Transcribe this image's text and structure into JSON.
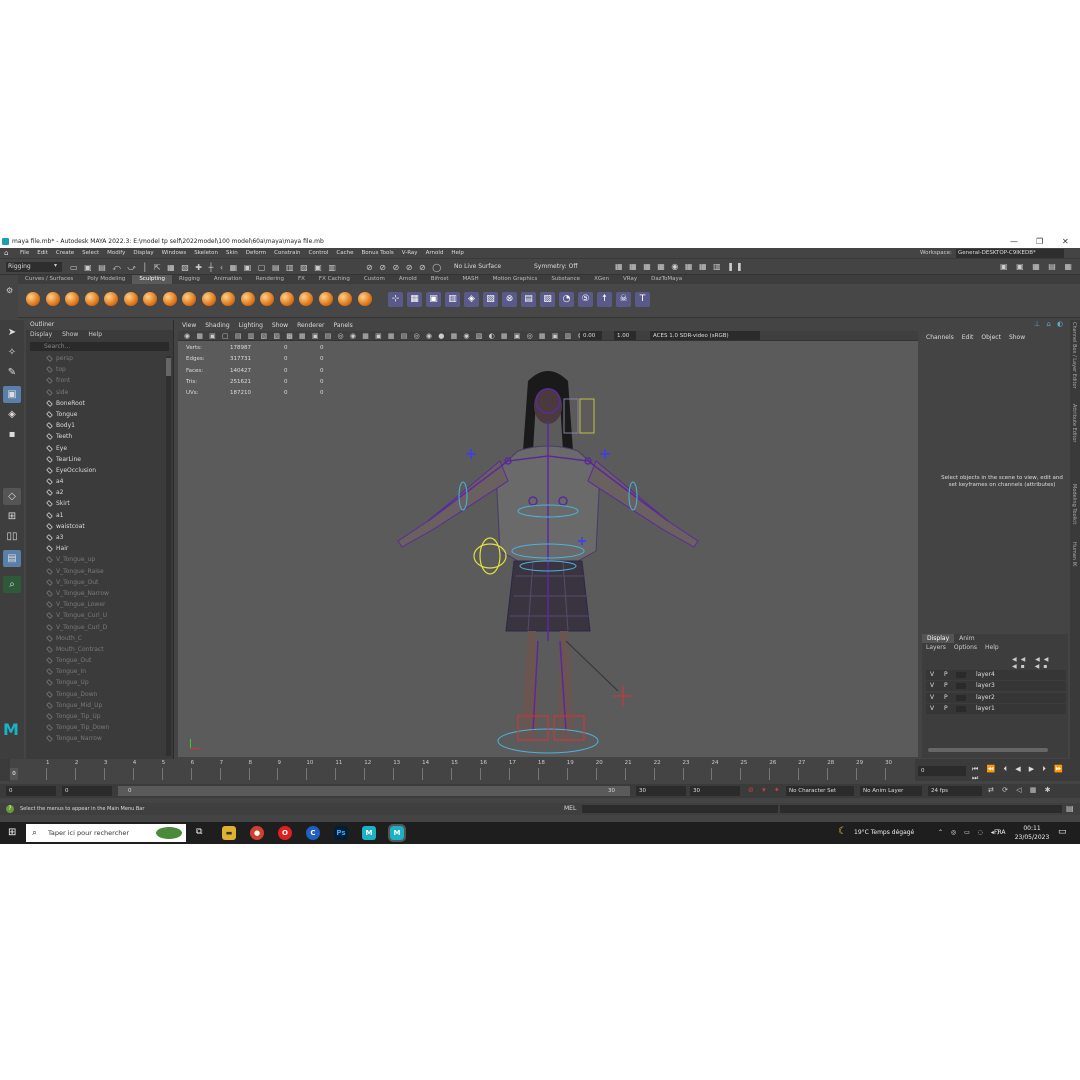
{
  "window": {
    "title": "maya file.mb* - Autodesk MAYA 2022.3: E:\\model tp self\\2022model\\100 model\\60a\\maya\\maya file.mb",
    "min": "—",
    "max": "❐",
    "close": "✕"
  },
  "menubar": {
    "items": [
      "File",
      "Edit",
      "Create",
      "Select",
      "Modify",
      "Display",
      "Windows",
      "Skeleton",
      "Skin",
      "Deform",
      "Constrain",
      "Control",
      "Cache",
      "Bonus Tools",
      "V-Ray",
      "Arnold",
      "Help"
    ],
    "workspace_label": "Workspace:",
    "workspace_value": "General-DESKTOP-C9IKEDB*"
  },
  "statusline": {
    "mode": "Rigging",
    "live_surface": "No Live Surface",
    "symmetry": "Symmetry: Off"
  },
  "shelf": {
    "tabs": [
      "Curves / Surfaces",
      "Poly Modeling",
      "Sculpting",
      "Rigging",
      "Animation",
      "Rendering",
      "FX",
      "FX Caching",
      "Custom",
      "Arnold",
      "Bifrost",
      "MASH",
      "Motion Graphics",
      "Substance",
      "XGen",
      "VRay",
      "DazToMaya"
    ],
    "active_tab": "Sculpting"
  },
  "outliner": {
    "title": "Outliner",
    "menu": [
      "Display",
      "Show",
      "Help"
    ],
    "search_placeholder": "Search...",
    "items": [
      {
        "label": "persp",
        "dim": true
      },
      {
        "label": "top",
        "dim": true
      },
      {
        "label": "front",
        "dim": true
      },
      {
        "label": "side",
        "dim": true
      },
      {
        "label": "BoneRoot",
        "dim": false
      },
      {
        "label": "Tongue",
        "dim": false
      },
      {
        "label": "Body1",
        "dim": false
      },
      {
        "label": "Teeth",
        "dim": false
      },
      {
        "label": "Eye",
        "dim": false
      },
      {
        "label": "TearLine",
        "dim": false
      },
      {
        "label": "EyeOcclusion",
        "dim": false
      },
      {
        "label": "a4",
        "dim": false
      },
      {
        "label": "a2",
        "dim": false
      },
      {
        "label": "Skirt",
        "dim": false
      },
      {
        "label": "a1",
        "dim": false
      },
      {
        "label": "waistcoat",
        "dim": false
      },
      {
        "label": "a3",
        "dim": false
      },
      {
        "label": "Hair",
        "dim": false
      },
      {
        "label": "V_Tongue_up",
        "dim": true
      },
      {
        "label": "V_Tongue_Raise",
        "dim": true
      },
      {
        "label": "V_Tongue_Out",
        "dim": true
      },
      {
        "label": "V_Tongue_Narrow",
        "dim": true
      },
      {
        "label": "V_Tongue_Lower",
        "dim": true
      },
      {
        "label": "V_Tongue_Curl_U",
        "dim": true
      },
      {
        "label": "V_Tongue_Curl_D",
        "dim": true
      },
      {
        "label": "Mouth_C",
        "dim": true
      },
      {
        "label": "Mouth_Contract",
        "dim": true
      },
      {
        "label": "Tongue_Out",
        "dim": true
      },
      {
        "label": "Tongue_In",
        "dim": true
      },
      {
        "label": "Tongue_Up",
        "dim": true
      },
      {
        "label": "Tongue_Down",
        "dim": true
      },
      {
        "label": "Tongue_Mid_Up",
        "dim": true
      },
      {
        "label": "Tongue_Tip_Up",
        "dim": true
      },
      {
        "label": "Tongue_Tip_Down",
        "dim": true
      },
      {
        "label": "Tongue_Narrow",
        "dim": true
      }
    ]
  },
  "viewport": {
    "menu": [
      "View",
      "Shading",
      "Lighting",
      "Show",
      "Renderer",
      "Panels"
    ],
    "exposure": "0.00",
    "gamma": "1.00",
    "colorspace": "ACES 1.0 SDR-video (sRGB)",
    "hud": [
      {
        "label": "Verts:",
        "total": "178987",
        "sel1": "0",
        "sel2": "0"
      },
      {
        "label": "Edges:",
        "total": "317731",
        "sel1": "0",
        "sel2": "0"
      },
      {
        "label": "Faces:",
        "total": "140427",
        "sel1": "0",
        "sel2": "0"
      },
      {
        "label": "Tris:",
        "total": "251621",
        "sel1": "0",
        "sel2": "0"
      },
      {
        "label": "UVs:",
        "total": "187210",
        "sel1": "0",
        "sel2": "0"
      }
    ]
  },
  "channelbox": {
    "menu": [
      "Channels",
      "Edit",
      "Object",
      "Show"
    ],
    "message": "Select objects in the scene to view, edit and set keyframes on channels (attributes)",
    "side_tabs": [
      "Channel Box / Layer Editor",
      "Attribute Editor",
      "Modeling Toolkit",
      "Human IK"
    ]
  },
  "layers": {
    "tabs": [
      "Display",
      "Anim"
    ],
    "menu": [
      "Layers",
      "Options",
      "Help"
    ],
    "rows": [
      {
        "v": "V",
        "p": "P",
        "name": "layer4"
      },
      {
        "v": "V",
        "p": "P",
        "name": "layer3"
      },
      {
        "v": "V",
        "p": "P",
        "name": "layer2"
      },
      {
        "v": "V",
        "p": "P",
        "name": "layer1"
      }
    ]
  },
  "timeslider": {
    "ticks": [
      "1",
      "2",
      "3",
      "4",
      "5",
      "6",
      "7",
      "8",
      "9",
      "10",
      "11",
      "12",
      "13",
      "14",
      "15",
      "16",
      "17",
      "18",
      "19",
      "20",
      "21",
      "22",
      "23",
      "24",
      "25",
      "26",
      "27",
      "28",
      "29",
      "30"
    ],
    "current": "0",
    "current_frame_field": "0"
  },
  "range": {
    "start": "0",
    "anim_start": "0",
    "range_start_label": "0",
    "range_end_label": "30",
    "end": "30",
    "anim_end": "30",
    "character_set": "No Character Set",
    "anim_layer": "No Anim Layer",
    "fps": "24 fps"
  },
  "cmdline": {
    "help_text": "Select the menus to appear in the Main Menu Bar",
    "mel": "MEL"
  },
  "taskbar": {
    "search": "Taper ici pour rechercher",
    "weather": "19°C  Temps dégagé",
    "lang": "FRA",
    "time": "00:11",
    "date": "23/05/2023",
    "apps": [
      "explorer",
      "chrome",
      "opera",
      "c-app",
      "Ps",
      "M",
      "M"
    ]
  },
  "colors": {
    "accent": "#4a90d9",
    "shelf_ball": "#e0781a",
    "rig_purple": "#5a2a9a"
  }
}
